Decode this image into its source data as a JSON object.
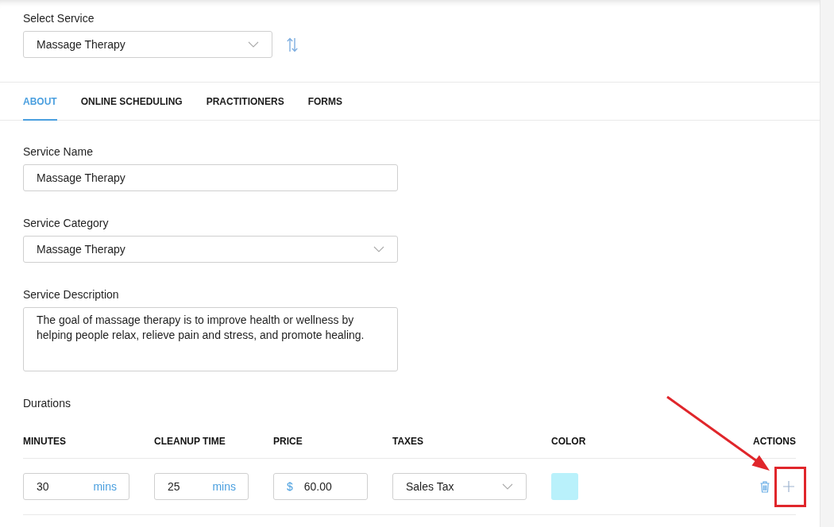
{
  "select_service": {
    "label": "Select Service",
    "value": "Massage Therapy"
  },
  "tabs": [
    {
      "label": "ABOUT",
      "selected": true
    },
    {
      "label": "ONLINE SCHEDULING",
      "selected": false
    },
    {
      "label": "PRACTITIONERS",
      "selected": false
    },
    {
      "label": "FORMS",
      "selected": false
    }
  ],
  "fields": [
    {
      "kind": "text",
      "label": "Service Name",
      "value": "Massage Therapy"
    },
    {
      "kind": "select",
      "label": "Service Category",
      "value": "Massage Therapy"
    },
    {
      "kind": "textarea",
      "label": "Service Description",
      "value": "The goal of massage therapy is to improve health or wellness by helping people relax, relieve pain and stress, and promote healing."
    }
  ],
  "durations": {
    "title": "Durations",
    "columns": [
      "MINUTES",
      "CLEANUP TIME",
      "PRICE",
      "TAXES",
      "COLOR",
      "ACTIONS"
    ],
    "rows": [
      {
        "minutes": {
          "value": "30",
          "unit": "mins"
        },
        "cleanup_time": {
          "value": "25",
          "unit": "mins"
        },
        "price": {
          "prefix": "$",
          "value": "60.00"
        },
        "taxes": "Sales Tax",
        "color": "#b9f1fb",
        "actions": [
          {
            "kind": "delete",
            "highlighted": false
          },
          {
            "kind": "add",
            "highlighted": true
          }
        ]
      }
    ]
  }
}
